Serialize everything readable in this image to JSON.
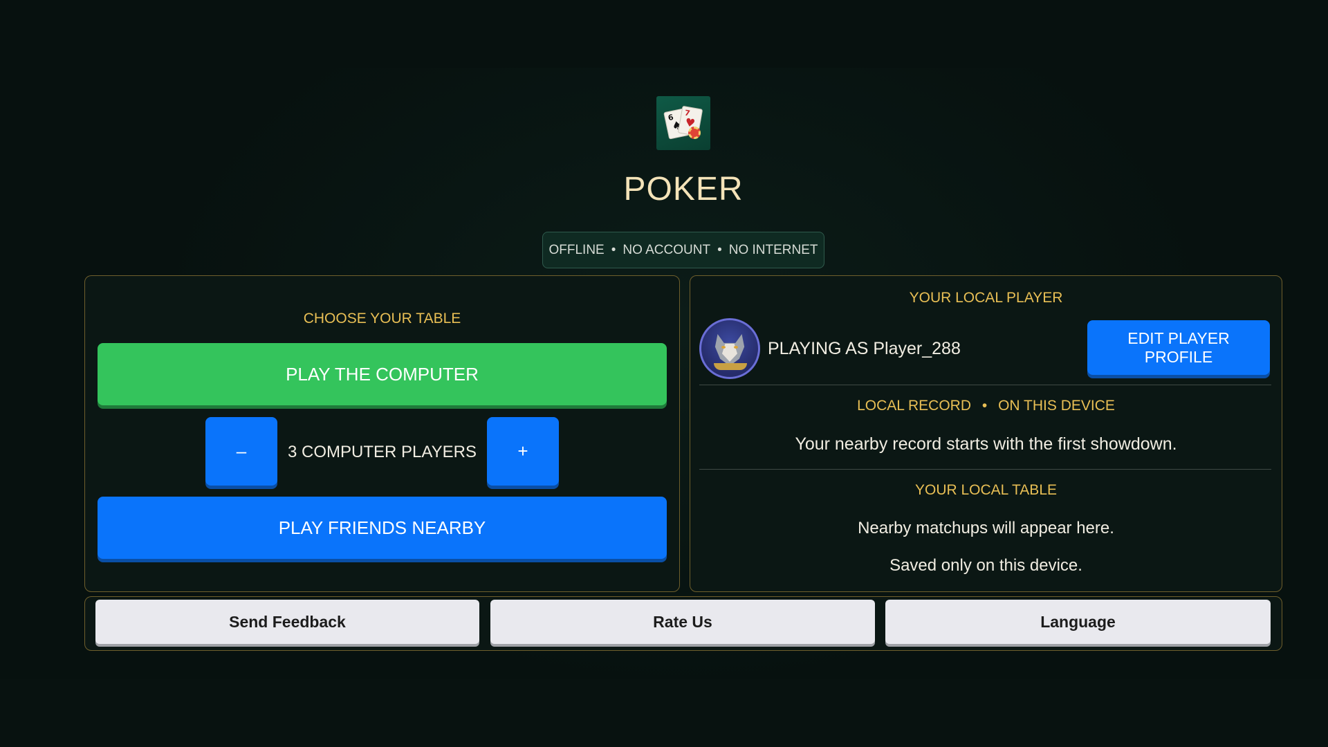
{
  "app": {
    "title": "POKER",
    "icon": "playing-cards-icon",
    "icon_cards": [
      {
        "rank": "6",
        "suit": "♠"
      },
      {
        "rank": "7",
        "suit": "♥"
      }
    ]
  },
  "status": {
    "parts": [
      "OFFLINE",
      "NO ACCOUNT",
      "NO INTERNET"
    ],
    "separator": "•"
  },
  "table": {
    "heading": "CHOOSE YOUR TABLE",
    "play_computer_label": "PLAY THE COMPUTER",
    "decrement_label": "–",
    "increment_label": "+",
    "computer_players_label": "3 COMPUTER PLAYERS",
    "play_friends_label": "PLAY FRIENDS NEARBY"
  },
  "player": {
    "heading": "YOUR LOCAL PLAYER",
    "avatar": "wolf-avatar",
    "playing_as": "PLAYING AS Player_288",
    "edit_profile_label": "EDIT PLAYER PROFILE",
    "record_heading_parts": [
      "LOCAL RECORD",
      "ON THIS DEVICE"
    ],
    "record_separator": "•",
    "record_text": "Your nearby record starts with the first showdown.",
    "local_table_heading": "YOUR LOCAL TABLE",
    "local_table_text": "Nearby matchups will appear here.",
    "saved_text": "Saved only on this device."
  },
  "footer": {
    "send_feedback_label": "Send Feedback",
    "rate_us_label": "Rate Us",
    "language_label": "Language"
  },
  "colors": {
    "background": "#07110f",
    "accent_gold": "#e9bf55",
    "title": "#f4e3b8",
    "green_button": "#34c45c",
    "blue_button": "#0a74fb",
    "footer_button": "#e9e9ee"
  }
}
